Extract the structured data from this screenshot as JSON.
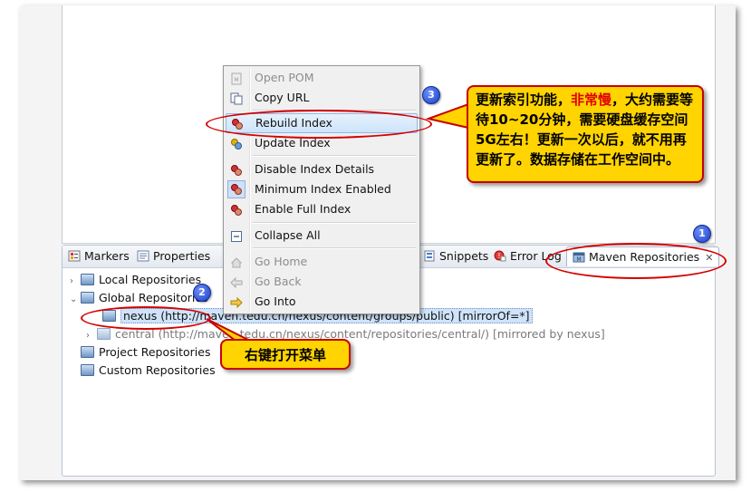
{
  "tabs": [
    {
      "label": "Markers",
      "icon": "markers-icon"
    },
    {
      "label": "Properties",
      "icon": "properties-icon"
    },
    {
      "label": "Snippets",
      "icon": "snippets-icon"
    },
    {
      "label": "Error Log",
      "icon": "error-log-icon"
    },
    {
      "label": "Maven Repositories",
      "icon": "maven-repositories-icon",
      "active": true,
      "close": "✕"
    }
  ],
  "tree": {
    "local": "Local Repositories",
    "global": "Global Repositories",
    "nexus": "nexus (http://maven.tedu.cn/nexus/content/groups/public) [mirrorOf=*]",
    "central": "central (http://maven.tedu.cn/nexus/content/repositories/central/) [mirrored by nexus]",
    "project": "Project Repositories",
    "custom": "Custom Repositories"
  },
  "menu": {
    "open_pom": "Open POM",
    "copy_url": "Copy URL",
    "rebuild_index": "Rebuild Index",
    "update_index": "Update Index",
    "disable_index_details": "Disable Index Details",
    "minimum_index_enabled": "Minimum Index Enabled",
    "enable_full_index": "Enable Full Index",
    "collapse_all": "Collapse All",
    "go_home": "Go Home",
    "go_back": "Go Back",
    "go_into": "Go Into"
  },
  "annotations": {
    "badge1": "1",
    "badge2": "2",
    "badge3": "3",
    "callout_top_pre": "更新索引功能，",
    "callout_top_red": "非常慢",
    "callout_top_post": "，大约需要等待10~20分钟，需要硬盘缓存空间5G左右！更新一次以后，就不用再更新了。数据存储在工作空间中。",
    "callout_bottom": "右键打开菜单"
  },
  "colors": {
    "callout_fill": "#ffd400",
    "callout_border": "#c80000",
    "ring": "#d40000",
    "badge": "#1b3fc7",
    "menu_highlight": "#cde4fb"
  }
}
